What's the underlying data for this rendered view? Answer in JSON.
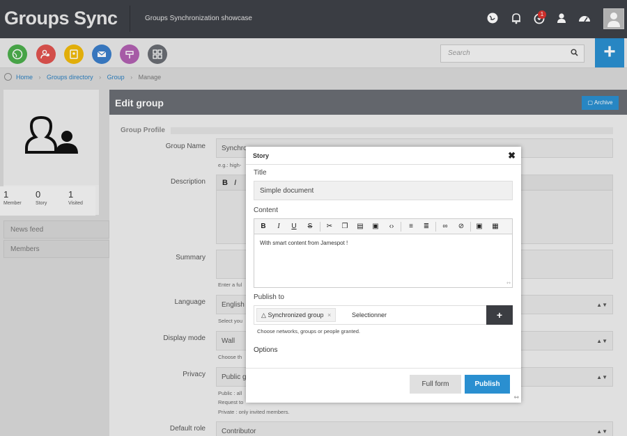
{
  "header": {
    "brand": "Groups Sync",
    "tagline": "Groups Synchronization showcase",
    "notification_count": "1",
    "icons": [
      "globe-icon",
      "bell-icon",
      "alert-icon",
      "user-icon",
      "dashboard-icon",
      "avatar"
    ]
  },
  "apps": [
    {
      "name": "globe-app-icon",
      "color": "#4cae4c"
    },
    {
      "name": "people-app-icon",
      "color": "#e0534f"
    },
    {
      "name": "contacts-app-icon",
      "color": "#f0b90b"
    },
    {
      "name": "mail-app-icon",
      "color": "#3b7ec9"
    },
    {
      "name": "signpost-app-icon",
      "color": "#b160b1"
    },
    {
      "name": "apps-grid-icon",
      "color": "#6a6d73"
    }
  ],
  "search": {
    "placeholder": "Search"
  },
  "breadcrumb": {
    "home": "Home",
    "directory": "Groups directory",
    "group": "Group",
    "current": "Manage"
  },
  "profile": {
    "stats": [
      {
        "value": "1",
        "label": "Member"
      },
      {
        "value": "0",
        "label": "Story"
      },
      {
        "value": "1",
        "label": "Visited"
      }
    ],
    "links": [
      "News feed",
      "Members"
    ]
  },
  "edit": {
    "title": "Edit group",
    "archive": "Archive",
    "section": "Group Profile",
    "fields": {
      "group_name_label": "Group Name",
      "group_name_value": "Synchro",
      "group_name_help": "e.g.: high-",
      "description_label": "Description",
      "summary_label": "Summary",
      "summary_help": "Enter a ful",
      "language_label": "Language",
      "language_value": "English",
      "language_help": "Select you",
      "display_label": "Display mode",
      "display_value": "Wall",
      "display_help": "Choose th",
      "privacy_label": "Privacy",
      "privacy_value": "Public g",
      "privacy_help1": "Public : all",
      "privacy_help2": "Request to",
      "privacy_help3": "Private : only invited members.",
      "role_label": "Default role",
      "role_value": "Contributor"
    }
  },
  "modal": {
    "title": "Story",
    "title_label": "Title",
    "title_value": "Simple document",
    "content_label": "Content",
    "content_value": "With smart content from Jamespot !",
    "publish_label": "Publish to",
    "chip": "Synchronized group",
    "select_placeholder": "Selectionner",
    "publish_help": "Choose networks, groups or people granted.",
    "options_label": "Options",
    "full_form": "Full form",
    "publish": "Publish"
  }
}
